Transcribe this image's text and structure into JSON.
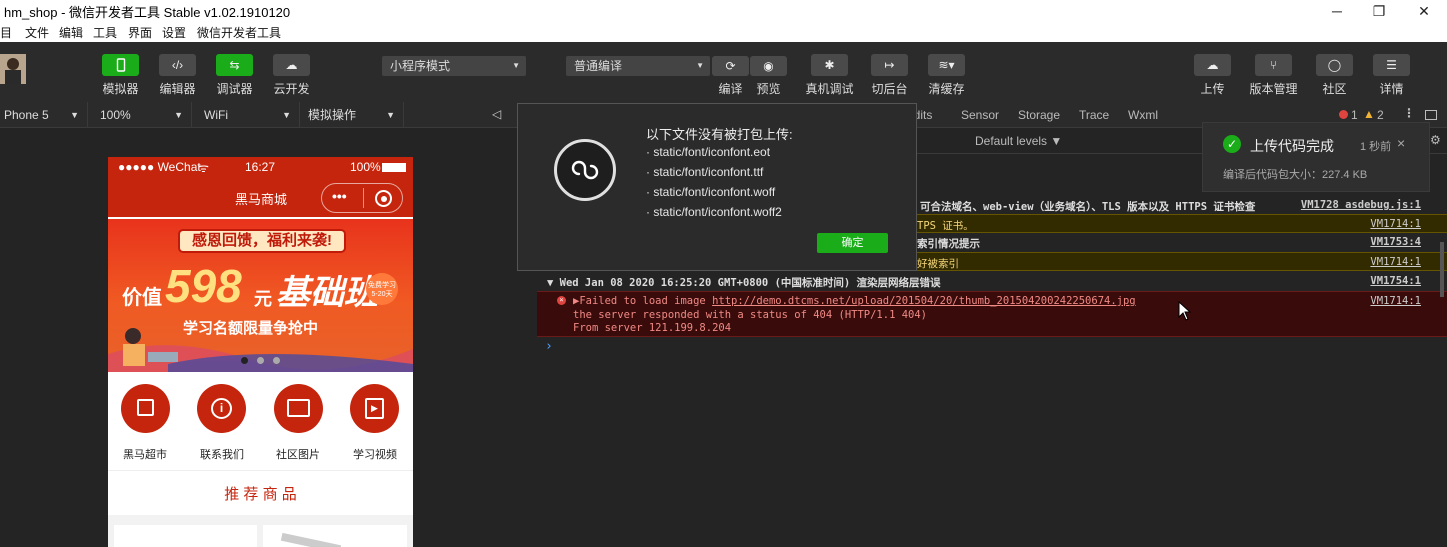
{
  "window": {
    "title": "hm_shop - 微信开发者工具 Stable v1.02.1910120",
    "minimize": "─",
    "maximize": "❐",
    "close": "✕"
  },
  "menu": [
    "目",
    "文件",
    "编辑",
    "工具",
    "界面",
    "设置",
    "微信开发者工具"
  ],
  "toolbar": {
    "simulator": "模拟器",
    "editor": "编辑器",
    "debugger": "调试器",
    "cloud": "云开发",
    "mode_select": "小程序模式",
    "compile_select": "普通编译",
    "compile": "编译",
    "preview": "预览",
    "remote_debug": "真机调试",
    "background": "切后台",
    "clear_cache": "清缓存",
    "upload": "上传",
    "version": "版本管理",
    "community": "社区",
    "details": "详情"
  },
  "subbar": {
    "device": "Phone 5",
    "zoom": "100%",
    "network": "WiFi",
    "operation": "模拟操作"
  },
  "phone": {
    "carrier": "●●●●● WeChat",
    "wifi": "ᯤ",
    "time": "16:27",
    "battery": "100%",
    "nav_title": "黑马商城",
    "banner_top": "感恩回馈，福利来袭!",
    "banner_price_prefix": "价值",
    "banner_price": "598",
    "banner_unit": "元",
    "banner_course": "基础班",
    "banner_badge_line1": "免费学习",
    "banner_badge_line2": "5-20天",
    "banner_sub": "学习名额限量争抢中",
    "categories": [
      "黑马超市",
      "联系我们",
      "社区图片",
      "学习视频"
    ],
    "recommend": "推  荐  商  品"
  },
  "devtools": {
    "tabs": [
      "udits",
      "Sensor",
      "Storage",
      "Trace",
      "Wxml"
    ],
    "error_count": "1",
    "warn_count": "2",
    "levels": "Default levels ▼",
    "logs": {
      "l1": "可合法域名、web-view（业务域名）、TLS 版本以及 HTTPS 证书检查",
      "l1_src": "VM1728 asdebug.js:1",
      "l2": "TPS 证书。",
      "l2_src": "VM1714:1",
      "l3": "索引情况提示",
      "l3_src": "VM1753:4",
      "l4": "好被索引",
      "l4_src": "VM1714:1",
      "l5": "▼ Wed Jan 08 2020 16:25:20 GMT+0800 (中国标准时间) 渲染层网络层错误",
      "l5_src": "VM1754:1",
      "err_prefix": "▶Failed to load image ",
      "err_url": "http://demo.dtcms.net/upload/201504/20/thumb_201504200242250674.jpg",
      "err_line2": "the server responded with a status of 404 (HTTP/1.1 404)",
      "err_line3": "From server 121.199.8.204",
      "err_src": "VM1714:1",
      "prompt": "›"
    }
  },
  "dialog": {
    "title": "以下文件没有被打包上传:",
    "files": [
      "· static/font/iconfont.eot",
      "· static/font/iconfont.ttf",
      "· static/font/iconfont.woff",
      "· static/font/iconfont.woff2"
    ],
    "confirm": "确定"
  },
  "toast": {
    "title": "上传代码完成",
    "time": "1 秒前",
    "close": "×",
    "detail": "编译后代码包大小：227.4 KB"
  }
}
